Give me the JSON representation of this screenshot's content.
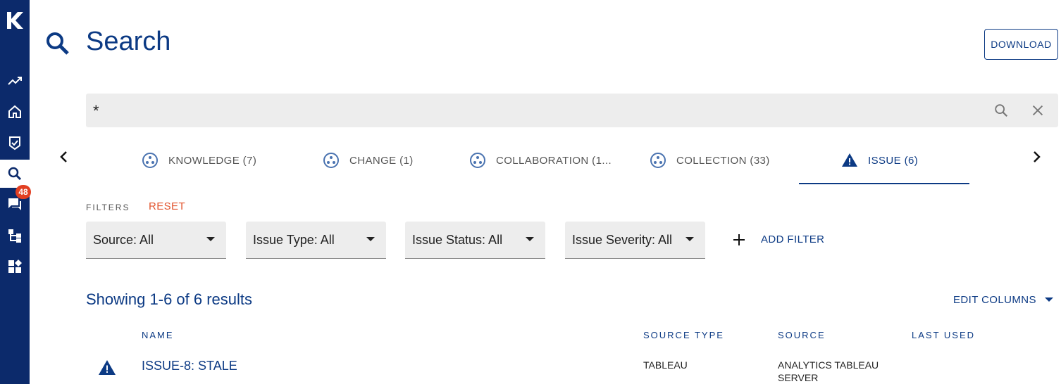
{
  "sidebar": {
    "logo_letter": "K",
    "badge_count": "48",
    "items": [
      {
        "icon": "trending-up-icon"
      },
      {
        "icon": "home-icon"
      },
      {
        "icon": "checklist-icon"
      },
      {
        "icon": "search-icon",
        "active": true
      },
      {
        "icon": "chat-icon"
      },
      {
        "icon": "hierarchy-icon"
      },
      {
        "icon": "dashboard-icon"
      }
    ]
  },
  "header": {
    "title": "Search",
    "download_label": "DOWNLOAD"
  },
  "search": {
    "value": "*"
  },
  "tabs": [
    {
      "label": "KNOWLEDGE (7)",
      "icon": "cluster-icon"
    },
    {
      "label": "CHANGE (1)",
      "icon": "cluster-icon"
    },
    {
      "label": "COLLABORATION (1...",
      "icon": "cluster-icon"
    },
    {
      "label": "COLLECTION (33)",
      "icon": "cluster-icon"
    },
    {
      "label": "ISSUE (6)",
      "icon": "warning-icon",
      "active": true
    }
  ],
  "filters": {
    "label": "FILTERS",
    "reset_label": "RESET",
    "items": [
      "Source: All",
      "Issue Type: All",
      "Issue Status: All",
      "Issue Severity: All"
    ],
    "add_label": "ADD FILTER"
  },
  "results": {
    "count_text": "Showing 1-6 of 6 results",
    "edit_columns_label": "EDIT COLUMNS",
    "columns": [
      "NAME",
      "SOURCE TYPE",
      "SOURCE",
      "LAST USED"
    ],
    "rows": [
      {
        "name": "ISSUE-8: STALE",
        "source_type": "TABLEAU",
        "source": "ANALYTICS TABLEAU SERVER",
        "last_used": ""
      }
    ]
  },
  "colors": {
    "sidebar": "#0c2a6b",
    "primary": "#0c3a84",
    "accent": "#e2542e",
    "badge": "#e23f22"
  }
}
